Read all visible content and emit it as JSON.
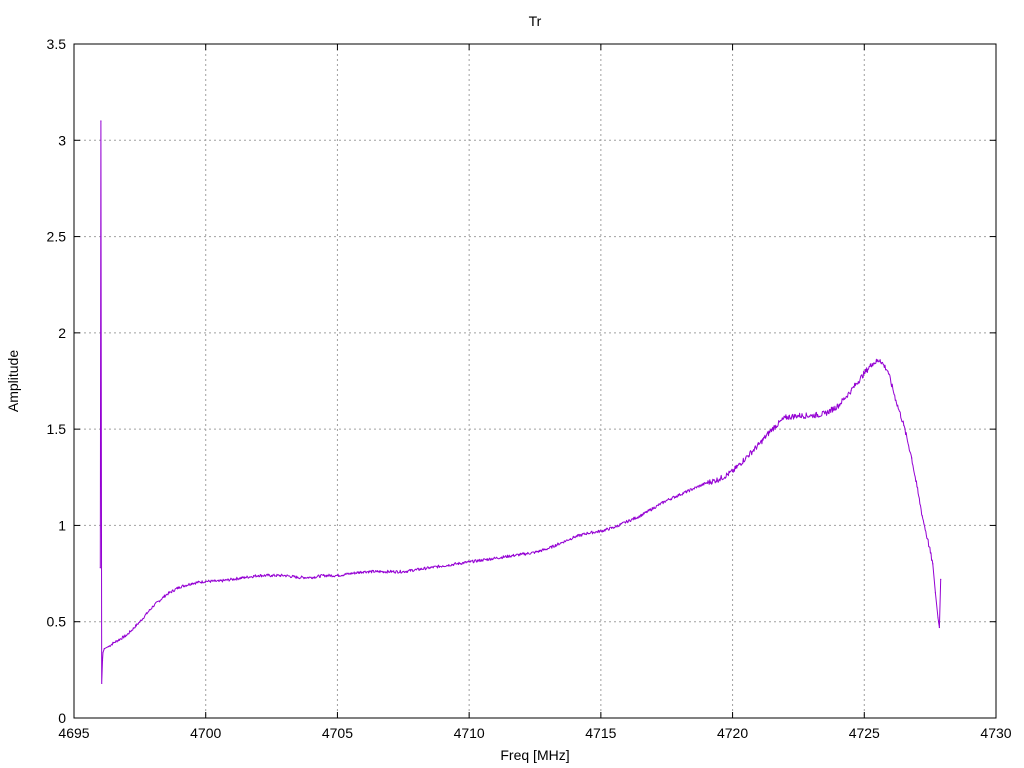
{
  "chart_data": {
    "type": "line",
    "title": "Tr",
    "xlabel": "Freq [MHz]",
    "ylabel": "Amplitude",
    "xlim": [
      4695,
      4730
    ],
    "ylim": [
      0,
      3.5
    ],
    "x_ticks": [
      4695,
      4700,
      4705,
      4710,
      4715,
      4720,
      4725,
      4730
    ],
    "x_tick_labels": [
      "4695",
      "4700",
      "4705",
      "4710",
      "4715",
      "4720",
      "4725",
      "4730"
    ],
    "y_ticks": [
      0,
      0.5,
      1,
      1.5,
      2,
      2.5,
      3,
      3.5
    ],
    "y_tick_labels": [
      "0",
      "0.5",
      "1",
      "1.5",
      "2",
      "2.5",
      "3",
      "3.5"
    ],
    "grid": true,
    "legend": "none",
    "series": [
      {
        "color": "#9400d3",
        "x": [
          4696.0,
          4696.02,
          4696.05,
          4696.08,
          4696.1,
          4696.15,
          4696.3,
          4696.5,
          4697.0,
          4697.5,
          4698.0,
          4698.5,
          4699.0,
          4699.5,
          4700.0,
          4700.5,
          4701.0,
          4701.5,
          4702.0,
          4702.5,
          4703.0,
          4703.5,
          4704.0,
          4704.5,
          4705.0,
          4705.5,
          4706.0,
          4706.5,
          4707.0,
          4707.5,
          4708.0,
          4708.5,
          4709.0,
          4709.5,
          4710.0,
          4710.5,
          4711.0,
          4711.5,
          4712.0,
          4712.5,
          4713.0,
          4713.5,
          4714.0,
          4714.5,
          4715.0,
          4715.5,
          4716.0,
          4716.5,
          4717.0,
          4717.5,
          4718.0,
          4718.5,
          4719.0,
          4719.5,
          4720.0,
          4720.5,
          4721.0,
          4721.5,
          4722.0,
          4722.5,
          4723.0,
          4723.5,
          4724.0,
          4724.5,
          4725.0,
          4725.3,
          4725.6,
          4725.9,
          4726.2,
          4726.5,
          4726.8,
          4727.0,
          4727.2,
          4727.4,
          4727.6,
          4727.7,
          4727.8,
          4727.85,
          4727.9
        ],
        "y": [
          0.78,
          3.1,
          0.18,
          0.3,
          0.34,
          0.36,
          0.37,
          0.39,
          0.43,
          0.5,
          0.58,
          0.64,
          0.68,
          0.7,
          0.71,
          0.71,
          0.72,
          0.73,
          0.74,
          0.74,
          0.74,
          0.73,
          0.73,
          0.74,
          0.74,
          0.75,
          0.76,
          0.76,
          0.76,
          0.76,
          0.77,
          0.78,
          0.79,
          0.8,
          0.81,
          0.82,
          0.83,
          0.84,
          0.85,
          0.86,
          0.88,
          0.91,
          0.94,
          0.96,
          0.97,
          0.99,
          1.02,
          1.05,
          1.09,
          1.13,
          1.16,
          1.19,
          1.22,
          1.24,
          1.28,
          1.35,
          1.42,
          1.5,
          1.56,
          1.57,
          1.57,
          1.58,
          1.62,
          1.7,
          1.79,
          1.84,
          1.86,
          1.8,
          1.65,
          1.52,
          1.35,
          1.2,
          1.05,
          0.93,
          0.8,
          0.65,
          0.52,
          0.47,
          0.72
        ]
      }
    ]
  }
}
